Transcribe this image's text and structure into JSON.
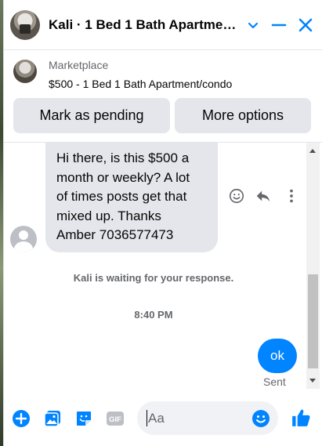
{
  "header": {
    "title": "Kali · 1 Bed 1 Bath Apartment/condo",
    "accent_color": "#0084ff"
  },
  "marketplace": {
    "label": "Marketplace",
    "listing": "$500 - 1 Bed 1 Bath Apartment/condo",
    "mark_pending_label": "Mark as pending",
    "more_options_label": "More options"
  },
  "messages": {
    "incoming": {
      "lines": [
        "Hi there, is this $500 a",
        "month or weekly? A lot",
        "of times posts get that",
        "mixed up. Thanks",
        "Amber 7036577473"
      ]
    },
    "waiting_text": "Kali is waiting for your response.",
    "timestamp": "8:40 PM",
    "outgoing": {
      "text": "ok",
      "status": "Sent"
    }
  },
  "composer": {
    "placeholder": "Aa",
    "icons": [
      "plus-icon",
      "photo-icon",
      "sticker-icon",
      "gif-icon",
      "emoji-icon",
      "like-icon"
    ]
  }
}
